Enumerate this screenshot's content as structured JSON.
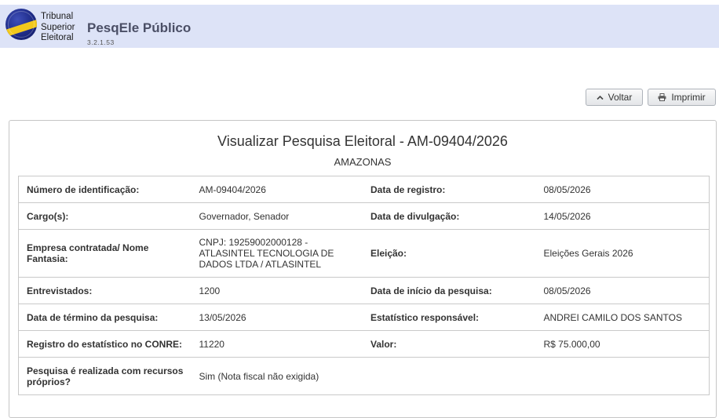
{
  "header": {
    "org_lines": [
      "Tribunal",
      "Superior",
      "Eleitoral"
    ],
    "app_title": "PesqEle Público",
    "version": "3.2.1.53"
  },
  "toolbar": {
    "back_label": "Voltar",
    "back_icon": "chevron-up-icon",
    "print_label": "Imprimir",
    "print_icon": "printer-icon"
  },
  "panel": {
    "title": "Visualizar Pesquisa Eleitoral - AM-09404/2026",
    "subtitle": "AMAZONAS",
    "rows": [
      {
        "l1": "Número de identificação:",
        "v1": "AM-09404/2026",
        "l2": "Data de registro:",
        "v2": "08/05/2026"
      },
      {
        "l1": "Cargo(s):",
        "v1": "Governador, Senador",
        "l2": "Data de divulgação:",
        "v2": "14/05/2026"
      },
      {
        "l1": "Empresa contratada/ Nome Fantasia:",
        "v1": "CNPJ: 19259002000128 - ATLASINTEL TECNOLOGIA DE DADOS LTDA / ATLASINTEL",
        "l2": "Eleição:",
        "v2": "Eleições Gerais 2026"
      },
      {
        "l1": "Entrevistados:",
        "v1": "1200",
        "l2": "Data de início da pesquisa:",
        "v2": "08/05/2026"
      },
      {
        "l1": "Data de término da pesquisa:",
        "v1": "13/05/2026",
        "l2": "Estatístico responsável:",
        "v2": "ANDREI CAMILO DOS SANTOS"
      },
      {
        "l1": "Registro do estatístico no CONRE:",
        "v1": "11220",
        "l2": "Valor:",
        "v2": "R$ 75.000,00"
      },
      {
        "l1": "Pesquisa é realizada com recursos próprios?",
        "v1": "Sim (Nota fiscal não exigida)",
        "l2": "",
        "v2": ""
      }
    ]
  }
}
